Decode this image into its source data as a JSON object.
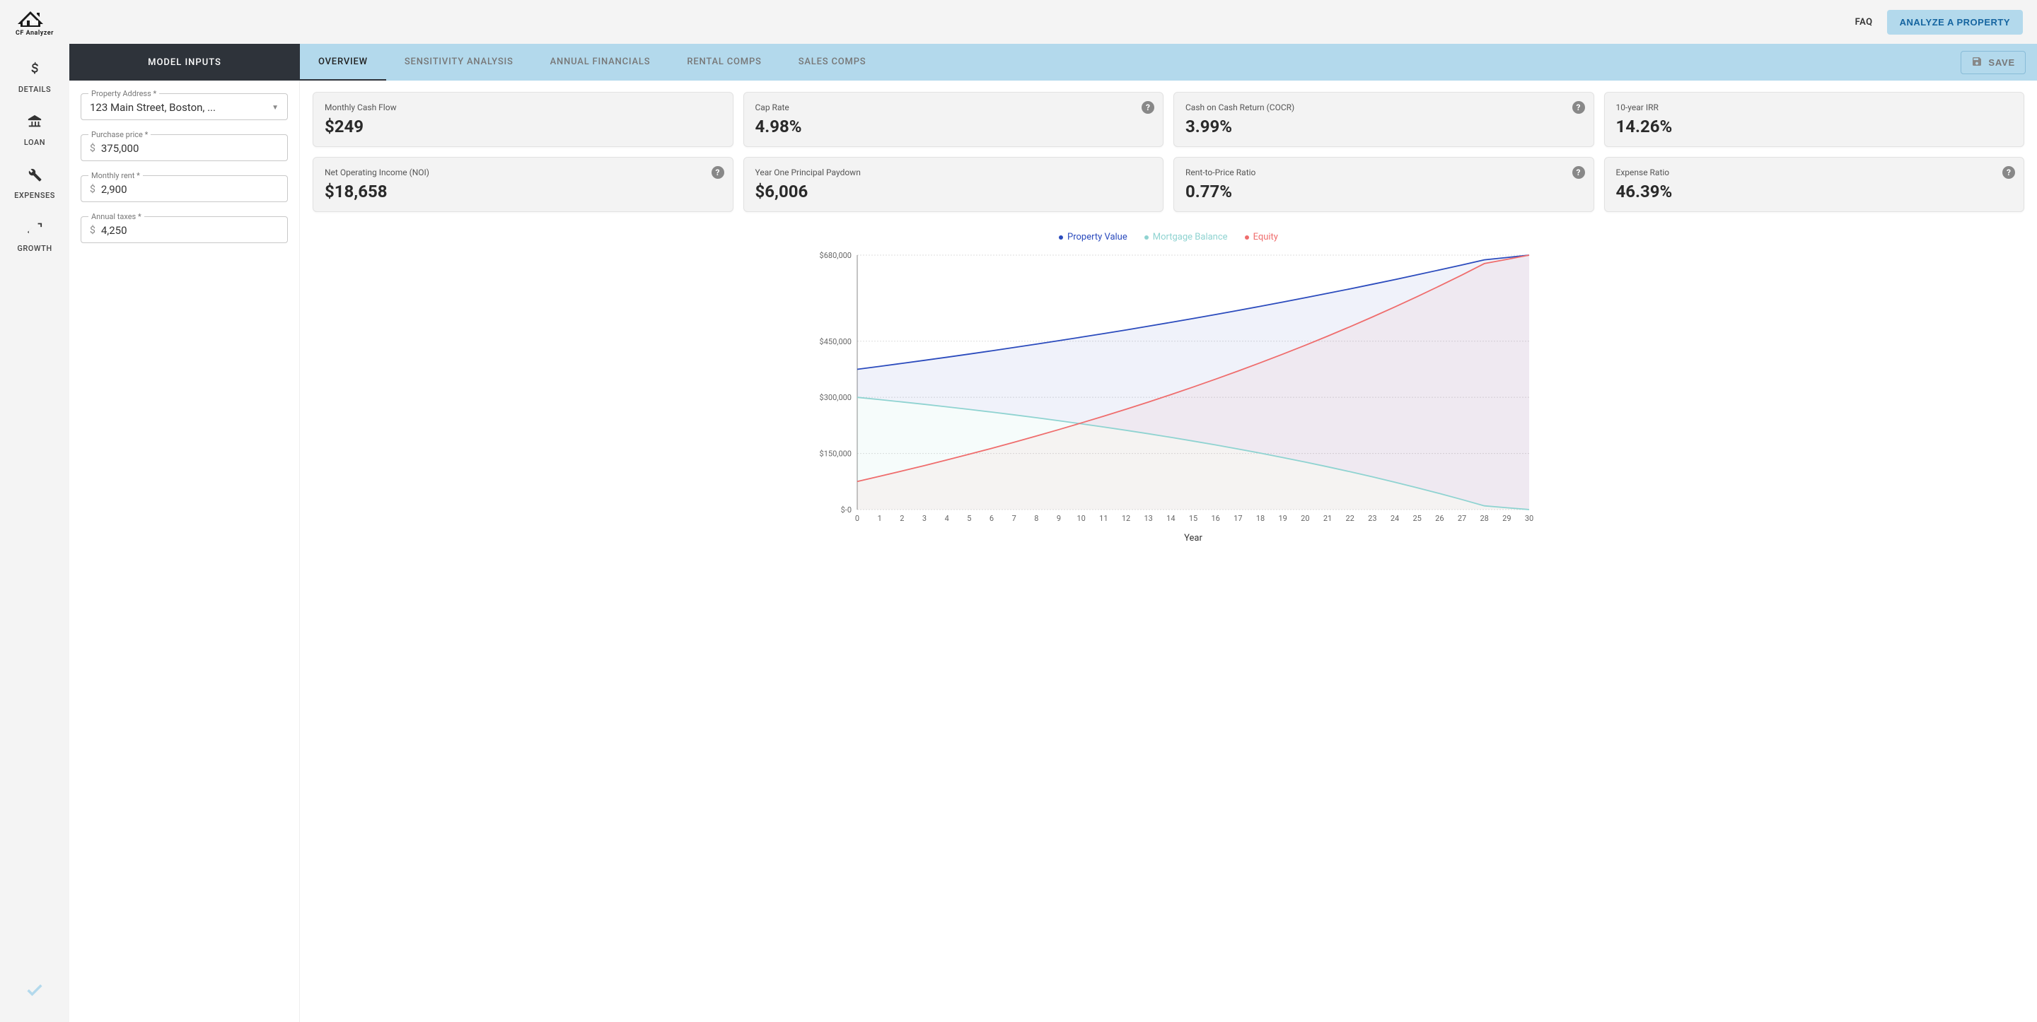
{
  "header": {
    "logo_text": "CF Analyzer",
    "faq": "FAQ",
    "analyze_btn": "ANALYZE A PROPERTY"
  },
  "sidebar": {
    "items": [
      {
        "icon": "dollar",
        "label": "DETAILS"
      },
      {
        "icon": "bank",
        "label": "LOAN"
      },
      {
        "icon": "wrench",
        "label": "EXPENSES"
      },
      {
        "icon": "trend",
        "label": "GROWTH"
      }
    ]
  },
  "tabs": {
    "left": "MODEL INPUTS",
    "items": [
      {
        "label": "OVERVIEW",
        "active": true
      },
      {
        "label": "SENSITIVITY ANALYSIS",
        "active": false
      },
      {
        "label": "ANNUAL FINANCIALS",
        "active": false
      },
      {
        "label": "RENTAL COMPS",
        "active": false
      },
      {
        "label": "SALES COMPS",
        "active": false
      }
    ],
    "save": "SAVE"
  },
  "inputs": {
    "address": {
      "label": "Property Address *",
      "value": "123 Main Street, Boston, ..."
    },
    "price": {
      "label": "Purchase price *",
      "value": "375,000",
      "prefix": "$"
    },
    "rent": {
      "label": "Monthly rent *",
      "value": "2,900",
      "prefix": "$"
    },
    "taxes": {
      "label": "Annual taxes *",
      "value": "4,250",
      "prefix": "$"
    }
  },
  "metrics": [
    {
      "label": "Monthly Cash Flow",
      "value": "$249",
      "help": false
    },
    {
      "label": "Cap Rate",
      "value": "4.98%",
      "help": true
    },
    {
      "label": "Cash on Cash Return (COCR)",
      "value": "3.99%",
      "help": true
    },
    {
      "label": "10-year IRR",
      "value": "14.26%",
      "help": false
    },
    {
      "label": "Net Operating Income (NOI)",
      "value": "$18,658",
      "help": true
    },
    {
      "label": "Year One Principal Paydown",
      "value": "$6,006",
      "help": false
    },
    {
      "label": "Rent-to-Price Ratio",
      "value": "0.77%",
      "help": true
    },
    {
      "label": "Expense Ratio",
      "value": "46.39%",
      "help": true
    }
  ],
  "chart_legend": {
    "pv": "Property Value",
    "mb": "Mortgage Balance",
    "eq": "Equity"
  },
  "chart_xlabel": "Year",
  "chart_data": {
    "type": "line",
    "title": "",
    "xlabel": "Year",
    "ylabel": "",
    "x": [
      0,
      1,
      2,
      3,
      4,
      5,
      6,
      7,
      8,
      9,
      10,
      11,
      12,
      13,
      14,
      15,
      16,
      17,
      18,
      19,
      20,
      21,
      22,
      23,
      24,
      25,
      26,
      27,
      28,
      29,
      30
    ],
    "ylim": [
      0,
      680000
    ],
    "y_ticks": [
      0,
      150000,
      300000,
      450000,
      680000
    ],
    "y_tick_labels": [
      "$-0",
      "$150,000",
      "$300,000",
      "$450,000",
      "$680,000"
    ],
    "series": [
      {
        "name": "Property Value",
        "color": "#2b4bbd",
        "values": [
          375000,
          382800,
          390800,
          398900,
          407200,
          415700,
          424300,
          433200,
          442200,
          451400,
          460800,
          470400,
          480100,
          490100,
          500300,
          510700,
          521400,
          532200,
          543300,
          554600,
          566100,
          577900,
          589900,
          602200,
          614700,
          627500,
          640600,
          653900,
          667500,
          673700,
          680000
        ]
      },
      {
        "name": "Mortgage Balance",
        "color": "#8fd3d1",
        "values": [
          300000,
          293900,
          287700,
          281300,
          274600,
          267700,
          260600,
          253200,
          245500,
          237600,
          229300,
          220800,
          211900,
          202700,
          193100,
          183100,
          172800,
          162000,
          150800,
          139100,
          127000,
          114400,
          101200,
          87500,
          73200,
          58400,
          42900,
          26800,
          10000,
          5000,
          0
        ]
      },
      {
        "name": "Equity",
        "color": "#ef6d6d",
        "values": [
          75000,
          88900,
          103100,
          117600,
          132600,
          148000,
          163700,
          180000,
          196700,
          213800,
          231500,
          249600,
          268200,
          287400,
          307200,
          327600,
          348600,
          370200,
          392500,
          415500,
          439100,
          463500,
          488700,
          514700,
          541500,
          569100,
          597700,
          627100,
          657500,
          668700,
          680000
        ]
      }
    ]
  }
}
